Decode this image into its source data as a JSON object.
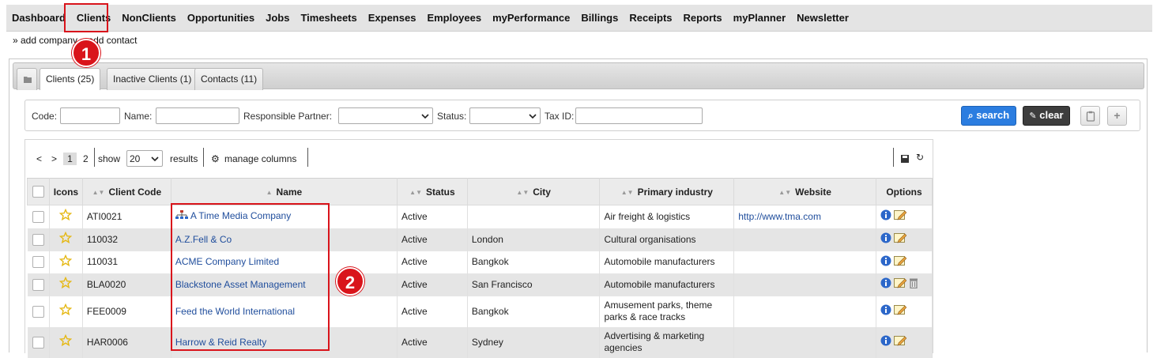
{
  "nav": [
    "Dashboard",
    "Clients",
    "NonClients",
    "Opportunities",
    "Jobs",
    "Timesheets",
    "Expenses",
    "Employees",
    "myPerformance",
    "Billings",
    "Receipts",
    "Reports",
    "myPlanner",
    "Newsletter"
  ],
  "sublinks": {
    "add_company": "» add company",
    "add_contact": "» add contact"
  },
  "annotations": {
    "badge1": "1",
    "badge2": "2",
    "color": "#d9141b"
  },
  "tabs": [
    "Clients (25)",
    "Inactive Clients (1)",
    "Contacts (11)"
  ],
  "filters": {
    "code": "Code:",
    "name": "Name:",
    "responsible_partner": "Responsible Partner:",
    "status": "Status:",
    "tax_id": "Tax ID:",
    "search": "search",
    "clear": "clear",
    "search_color": "#2b7de0",
    "clear_color": "#3d3d3d"
  },
  "pager": {
    "prev": "<",
    "next": ">",
    "page1": "1",
    "page2": "2",
    "show": "show",
    "per_page": "20",
    "results": "results",
    "manage_columns": "manage columns"
  },
  "columns": {
    "icons": "Icons",
    "code": "Client Code",
    "name": "Name",
    "status": "Status",
    "city": "City",
    "industry": "Primary industry",
    "website": "Website",
    "options": "Options"
  },
  "rows": [
    {
      "code": "ATI0021",
      "name": "A Time Media Company",
      "status": "Active",
      "city": "",
      "industry": "Air freight & logistics",
      "website": "http://www.tma.com"
    },
    {
      "code": "110032",
      "name": "A.Z.Fell & Co",
      "status": "Active",
      "city": "London",
      "industry": "Cultural organisations",
      "website": ""
    },
    {
      "code": "110031",
      "name": "ACME Company Limited",
      "status": "Active",
      "city": "Bangkok",
      "industry": "Automobile manufacturers",
      "website": ""
    },
    {
      "code": "BLA0020",
      "name": "Blackstone Asset Management",
      "status": "Active",
      "city": "San Francisco",
      "industry": "Automobile manufacturers",
      "website": ""
    },
    {
      "code": "FEE0009",
      "name": "Feed the World International",
      "status": "Active",
      "city": "Bangkok",
      "industry": "Amusement parks, theme parks & race tracks",
      "website": ""
    },
    {
      "code": "HAR0006",
      "name": "Harrow & Reid Realty",
      "status": "Active",
      "city": "Sydney",
      "industry": "Advertising & marketing agencies",
      "website": ""
    }
  ]
}
